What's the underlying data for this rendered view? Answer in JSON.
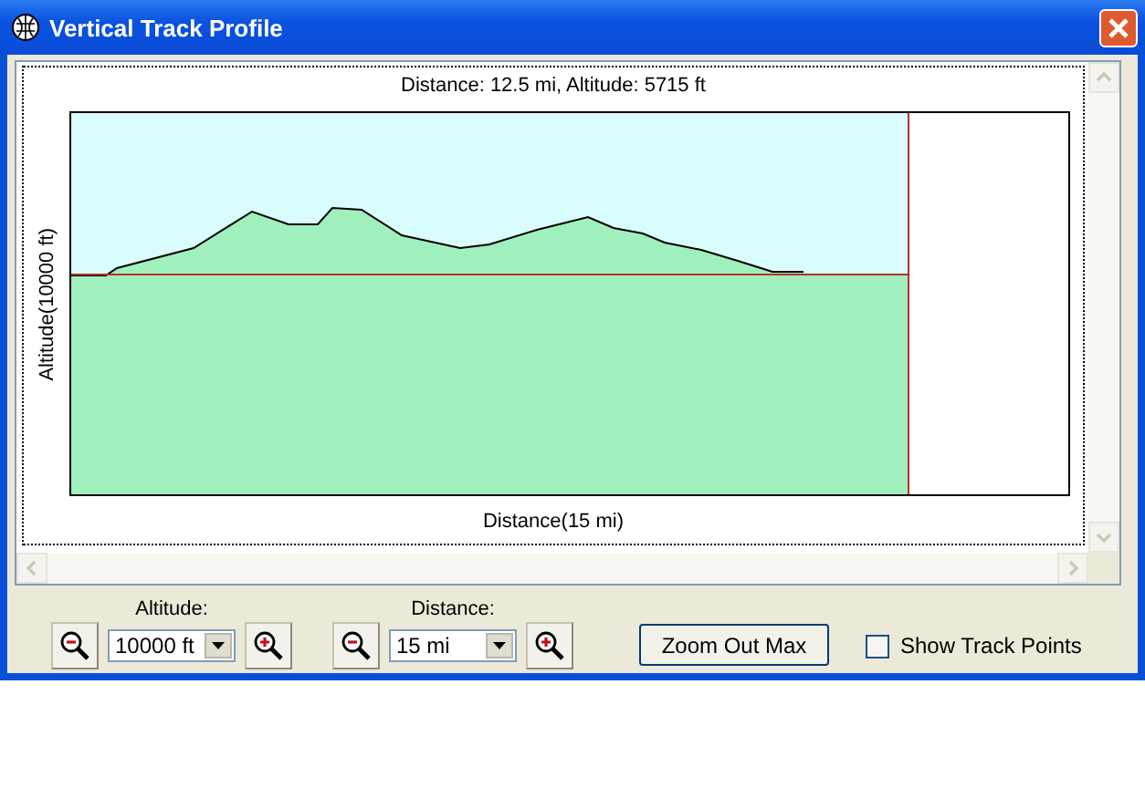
{
  "window": {
    "title": "Vertical Track Profile"
  },
  "profile": {
    "readout": "Distance: 12.5 mi, Altitude: 5715 ft",
    "ylabel": "Altitude(10000 ft)",
    "xlabel": "Distance(15 mi)"
  },
  "controls": {
    "altitude": {
      "label": "Altitude:",
      "value": "10000 ft"
    },
    "distance": {
      "label": "Distance:",
      "value": "15 mi"
    },
    "zoom_out_max": "Zoom Out Max",
    "show_track_points": {
      "label": "Show Track Points",
      "checked": false
    }
  }
}
